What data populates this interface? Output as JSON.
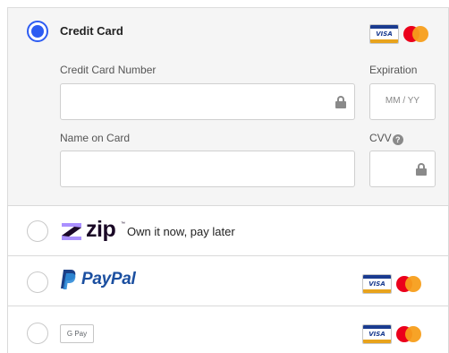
{
  "payment_options": {
    "credit_card": {
      "label": "Credit Card",
      "selected": true,
      "brand_icons": [
        "visa-icon",
        "mastercard-icon"
      ],
      "card_number": {
        "label": "Credit Card Number",
        "value": ""
      },
      "expiration": {
        "label": "Expiration",
        "placeholder": "MM / YY",
        "value": ""
      },
      "name_on_card": {
        "label": "Name on Card",
        "value": ""
      },
      "cvv": {
        "label": "CVV",
        "help_glyph": "?",
        "value": ""
      }
    },
    "zip": {
      "logo_text": "zip",
      "tagline": "Own it now, pay later",
      "selected": false
    },
    "paypal": {
      "logo_text": "PayPal",
      "selected": false
    },
    "google_pay": {
      "logo_text": "G Pay",
      "selected": false
    }
  },
  "visa_text": "VISA",
  "colors": {
    "accent_radio": "#2d5cf2",
    "visa_blue": "#1a3b8f",
    "mastercard_red": "#eb001b",
    "mastercard_orange": "#f79e1b",
    "paypal_blue": "#1b4fa0",
    "zip_purple": "#aa8fff",
    "zip_dark": "#1a0826"
  }
}
